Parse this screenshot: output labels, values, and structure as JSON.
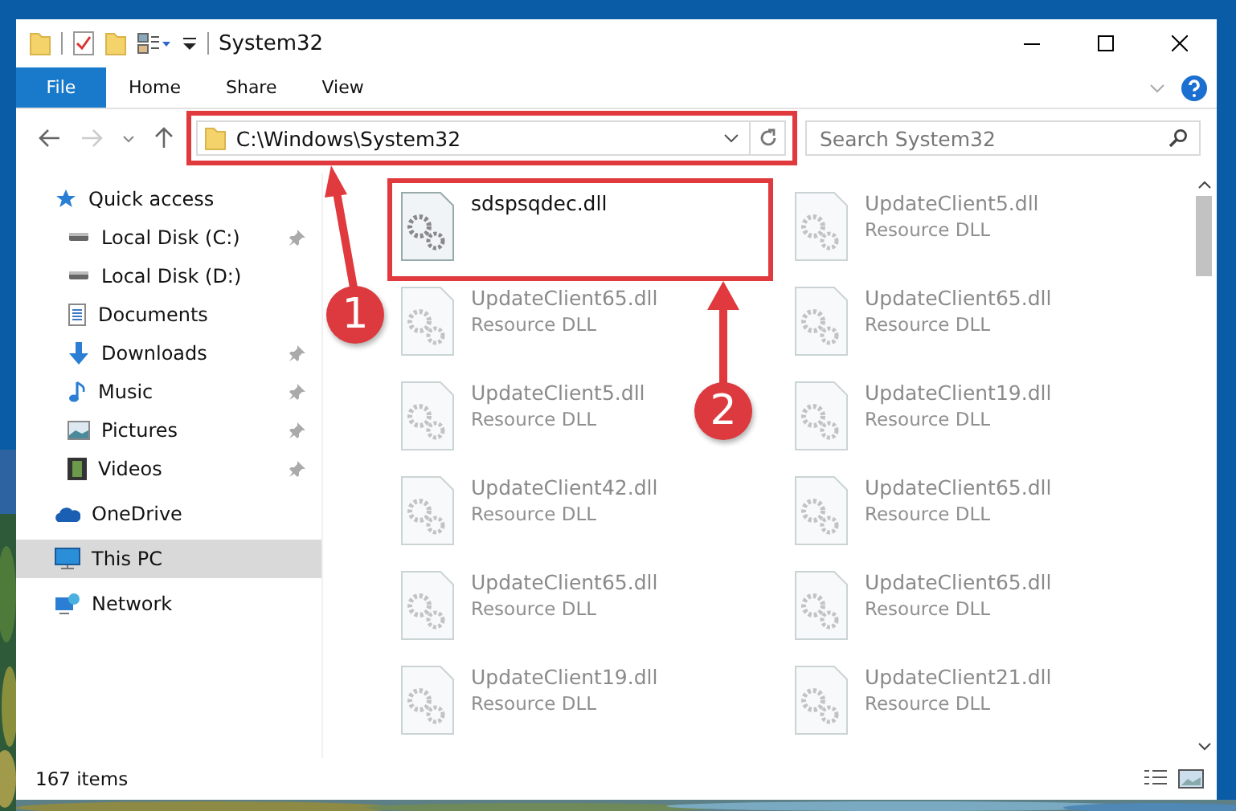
{
  "window": {
    "title": "System32"
  },
  "ribbon_tabs": [
    {
      "label": "File",
      "selected": true
    },
    {
      "label": "Home",
      "selected": false
    },
    {
      "label": "Share",
      "selected": false
    },
    {
      "label": "View",
      "selected": false
    }
  ],
  "address": {
    "value": "C:\\Windows\\System32"
  },
  "search": {
    "placeholder": "Search System32"
  },
  "nav": [
    {
      "label": "Quick access",
      "kind": "star",
      "pinned": false,
      "selected": false,
      "group": true
    },
    {
      "label": "Local Disk (C:)",
      "kind": "disk",
      "pinned": true,
      "selected": false,
      "group": false
    },
    {
      "label": "Local Disk (D:)",
      "kind": "disk",
      "pinned": false,
      "selected": false,
      "group": false
    },
    {
      "label": "Documents",
      "kind": "document",
      "pinned": false,
      "selected": false,
      "group": false
    },
    {
      "label": "Downloads",
      "kind": "download",
      "pinned": true,
      "selected": false,
      "group": false
    },
    {
      "label": "Music",
      "kind": "music",
      "pinned": true,
      "selected": false,
      "group": false
    },
    {
      "label": "Pictures",
      "kind": "pictures",
      "pinned": true,
      "selected": false,
      "group": false
    },
    {
      "label": "Videos",
      "kind": "video",
      "pinned": true,
      "selected": false,
      "group": false
    },
    {
      "label": "OneDrive",
      "kind": "cloud",
      "pinned": false,
      "selected": false,
      "group": true
    },
    {
      "label": "This PC",
      "kind": "pc",
      "pinned": false,
      "selected": true,
      "group": true
    },
    {
      "label": "Network",
      "kind": "network",
      "pinned": false,
      "selected": false,
      "group": true
    }
  ],
  "files": [
    {
      "name": "sdspsqdec.dll",
      "dimmed": false
    },
    {
      "name": "UpdateClient5.dll",
      "type": "Resource DLL",
      "dimmed": true
    },
    {
      "name": "UpdateClient65.dll",
      "type": "Resource DLL",
      "dimmed": true
    },
    {
      "name": "UpdateClient65.dll",
      "type": "Resource DLL",
      "dimmed": true
    },
    {
      "name": "UpdateClient5.dll",
      "type": "Resource DLL",
      "dimmed": true
    },
    {
      "name": "UpdateClient19.dll",
      "type": "Resource DLL",
      "dimmed": true
    },
    {
      "name": "UpdateClient42.dll",
      "type": "Resource DLL",
      "dimmed": true
    },
    {
      "name": "UpdateClient65.dll",
      "type": "Resource DLL",
      "dimmed": true
    },
    {
      "name": "UpdateClient65.dll",
      "type": "Resource DLL",
      "dimmed": true
    },
    {
      "name": "UpdateClient65.dll",
      "type": "Resource DLL",
      "dimmed": true
    },
    {
      "name": "UpdateClient19.dll",
      "type": "Resource DLL",
      "dimmed": true
    },
    {
      "name": "UpdateClient21.dll",
      "type": "Resource DLL",
      "dimmed": true
    }
  ],
  "status_bar": {
    "item_count": "167 items"
  },
  "annotations": [
    {
      "number": "1"
    },
    {
      "number": "2"
    }
  ]
}
